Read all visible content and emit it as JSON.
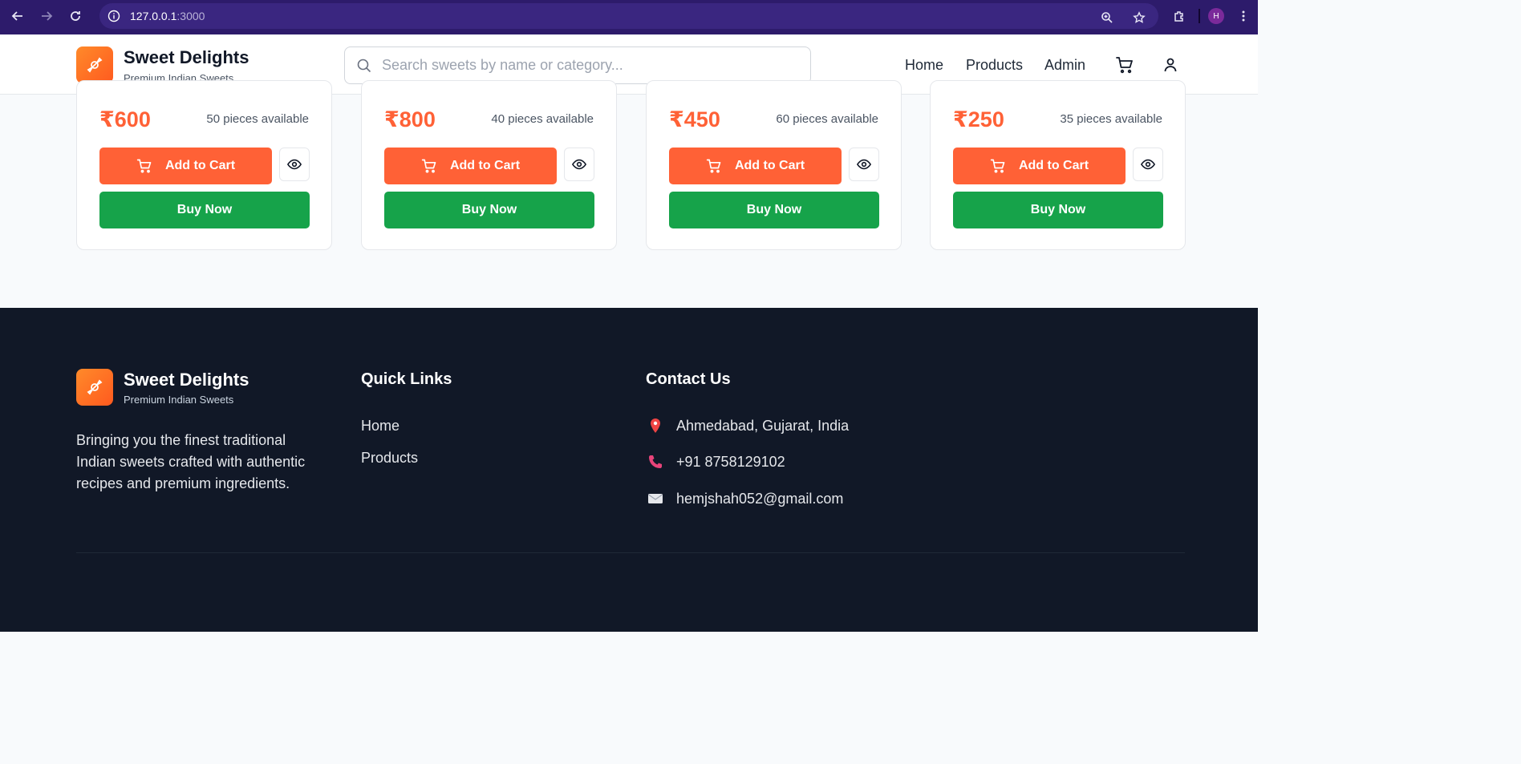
{
  "browser": {
    "url_host": "127.0.0.1",
    "url_port": ":3000",
    "profile_initial": "H"
  },
  "header": {
    "brand_name": "Sweet Delights",
    "brand_tagline": "Premium Indian Sweets",
    "search_placeholder": "Search sweets by name or category...",
    "nav": {
      "home": "Home",
      "products": "Products",
      "admin": "Admin"
    }
  },
  "products": [
    {
      "price": "₹600",
      "stock": "50 pieces available",
      "add_label": "Add to Cart",
      "buy_label": "Buy Now"
    },
    {
      "price": "₹800",
      "stock": "40 pieces available",
      "add_label": "Add to Cart",
      "buy_label": "Buy Now"
    },
    {
      "price": "₹450",
      "stock": "60 pieces available",
      "add_label": "Add to Cart",
      "buy_label": "Buy Now"
    },
    {
      "price": "₹250",
      "stock": "35 pieces available",
      "add_label": "Add to Cart",
      "buy_label": "Buy Now"
    }
  ],
  "footer": {
    "brand_name": "Sweet Delights",
    "brand_tagline": "Premium Indian Sweets",
    "description": "Bringing you the finest traditional Indian sweets crafted with authentic recipes and premium ingredients.",
    "quick_links_title": "Quick Links",
    "quick_links": [
      "Home",
      "Products"
    ],
    "contact_title": "Contact Us",
    "contact": {
      "address": "Ahmedabad, Gujarat, India",
      "phone": "+91 8758129102",
      "email": "hemjshah052@gmail.com"
    }
  },
  "colors": {
    "accent_orange": "#ff6136",
    "buy_green": "#16a34a",
    "footer_bg": "#111827",
    "chrome_bg": "#2d1b6b"
  }
}
